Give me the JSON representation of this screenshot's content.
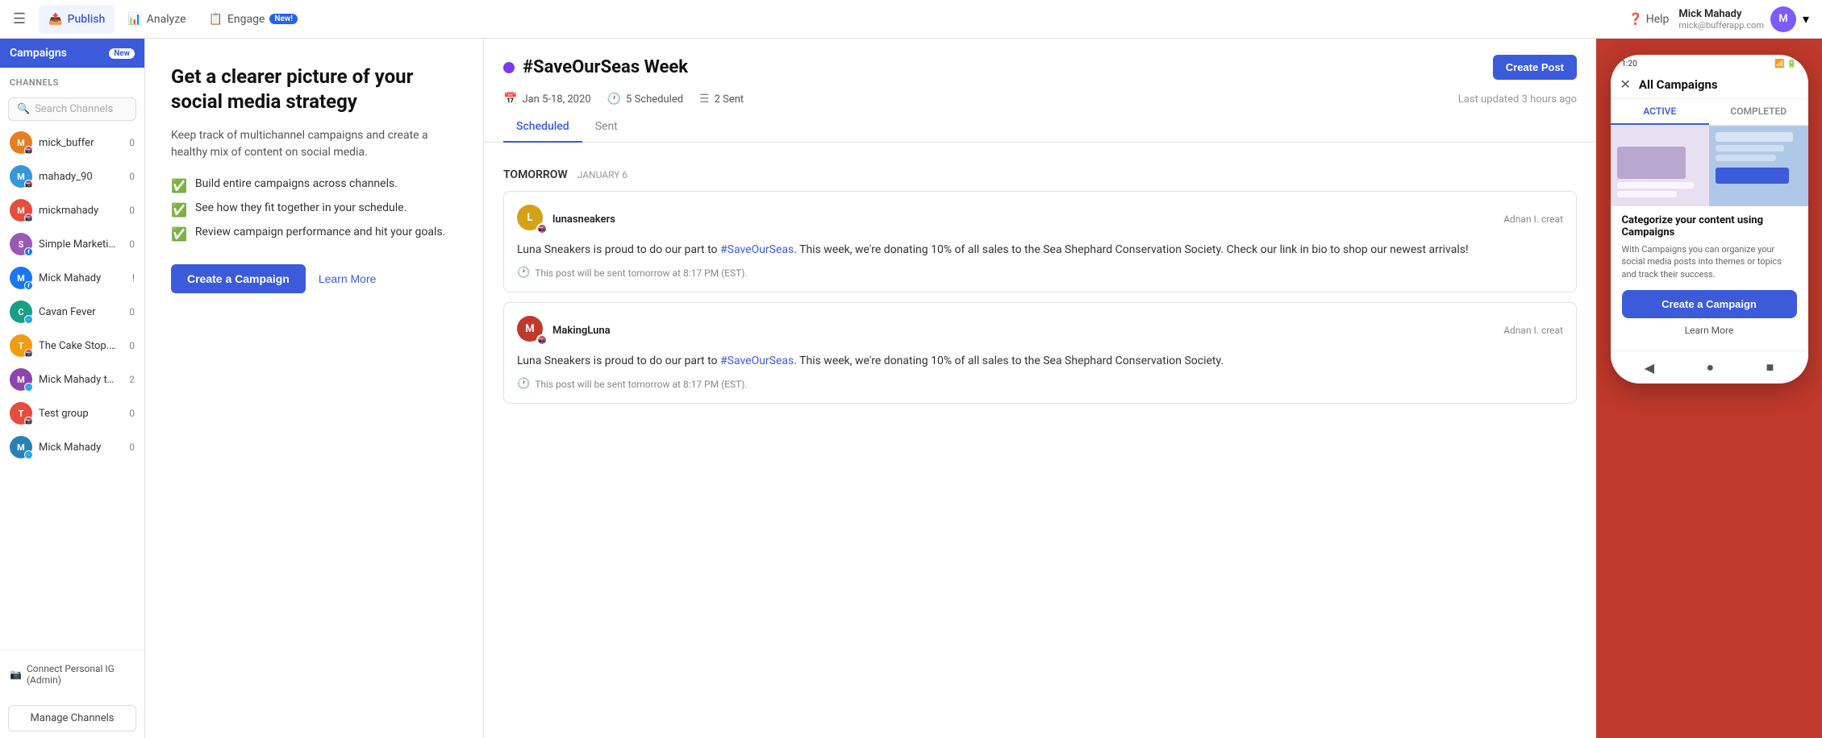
{
  "nav": {
    "menu_icon": "☰",
    "tabs": [
      {
        "id": "publish",
        "label": "Publish",
        "icon": "📤",
        "active": true
      },
      {
        "id": "analyze",
        "label": "Analyze",
        "icon": "📊",
        "active": false
      },
      {
        "id": "engage",
        "label": "Engage",
        "icon": "📋",
        "active": false,
        "badge": "New!"
      }
    ],
    "help_label": "Help",
    "user": {
      "name": "Mick Mahady",
      "email": "mick@bufferapp.com"
    }
  },
  "sidebar": {
    "campaigns_label": "Campaigns",
    "campaigns_badge": "New",
    "channels_section": "Channels",
    "search_placeholder": "Search Channels",
    "channels": [
      {
        "id": "mick_buffer",
        "name": "mick_buffer",
        "count": "0",
        "bg": "#e67e22",
        "initials": "M",
        "platform": "ig"
      },
      {
        "id": "mahady_90",
        "name": "mahady_90",
        "count": "0",
        "bg": "#3498db",
        "initials": "M",
        "platform": "ig"
      },
      {
        "id": "mickmahady",
        "name": "mickmahady",
        "count": "0",
        "bg": "#e74c3c",
        "initials": "M",
        "platform": "ig"
      },
      {
        "id": "simple_marketing",
        "name": "Simple Marketing",
        "count": "0",
        "bg": "#9b59b6",
        "initials": "S",
        "platform": "fb"
      },
      {
        "id": "mick_mahady",
        "name": "Mick Mahady",
        "count": "!",
        "countRed": true,
        "bg": "#1877f2",
        "initials": "M",
        "platform": "fb"
      },
      {
        "id": "cavan_fever",
        "name": "Cavan Fever",
        "count": "0",
        "bg": "#16a085",
        "initials": "C",
        "platform": "tw"
      },
      {
        "id": "the_cake_stop",
        "name": "The Cake Stop.ie",
        "count": "0",
        "bg": "#f39c12",
        "initials": "T",
        "platform": "ig"
      },
      {
        "id": "mick_test",
        "name": "Mick Mahady test",
        "count": "2",
        "bg": "#8e44ad",
        "initials": "M",
        "platform": "tw"
      },
      {
        "id": "test_group",
        "name": "Test group",
        "count": "0",
        "bg": "#e74c3c",
        "initials": "T",
        "platform": "ig"
      },
      {
        "id": "mick_mahady2",
        "name": "Mick Mahady",
        "count": "0",
        "bg": "#2980b9",
        "initials": "M",
        "platform": "tw"
      }
    ],
    "connect_ig": "Connect Personal IG (Admin)",
    "manage_channels": "Manage Channels"
  },
  "overview": {
    "heading": "Get a clearer picture of your social media strategy",
    "subtitle": "Keep track of multichannel campaigns and create a healthy mix of content on social media.",
    "features": [
      "Build entire campaigns across channels.",
      "See how they fit together in your schedule.",
      "Review campaign performance and hit your goals."
    ],
    "create_btn": "Create a Campaign",
    "learn_btn": "Learn More"
  },
  "campaign": {
    "title": "#SaveOurSeas Week",
    "date_range": "Jan 5-18, 2020",
    "scheduled_count": "5 Scheduled",
    "sent_count": "2 Sent",
    "last_updated": "Last updated 3 hours ago",
    "create_post_btn": "Create Post",
    "tabs": [
      {
        "id": "scheduled",
        "label": "Scheduled",
        "active": true
      },
      {
        "id": "sent",
        "label": "Sent",
        "active": false
      }
    ],
    "days": [
      {
        "label": "Tomorrow",
        "date": "JANUARY 6",
        "posts": [
          {
            "author": "lunasneakers",
            "credit": "Adnan I. creat",
            "avatar_bg": "#d4a017",
            "initials": "L",
            "platform": "ig",
            "body1": "Luna Sneakers is proud to do our part to ",
            "link": "#SaveOurSeas",
            "body2": ". This week, we're donating 10% of all sales to the Sea Shephard Conservation Society.\n\nCheck our link in bio to shop our newest arrivals!",
            "schedule": "This post will be sent tomorrow at 8:17 PM (EST)."
          },
          {
            "author": "MakingLuna",
            "credit": "Adnan I. creat",
            "avatar_bg": "#c0392b",
            "initials": "M",
            "platform": "ig",
            "body1": "Luna Sneakers is proud to do our part to ",
            "link": "#SaveOurSeas",
            "body2": ". This week, we're donating 10% of all sales to the Sea Shephard Conservation Society.",
            "schedule": "This post will be sent tomorrow at 8:17 PM (EST)."
          }
        ]
      }
    ]
  },
  "phone": {
    "time": "1:20",
    "title": "All Campaigns",
    "close_icon": "✕",
    "tabs": [
      {
        "label": "ACTIVE",
        "active": true
      },
      {
        "label": "COMPLETED",
        "active": false
      }
    ],
    "categorize_heading": "Categorize your content using Campaigns",
    "categorize_body": "With Campaigns you can organize your social media posts into themes or topics and track their success.",
    "create_btn": "Create a Campaign",
    "learn_more": "Learn More",
    "fab_icon": "✎",
    "nav_back": "◀",
    "nav_home": "●",
    "nav_recent": "■"
  }
}
